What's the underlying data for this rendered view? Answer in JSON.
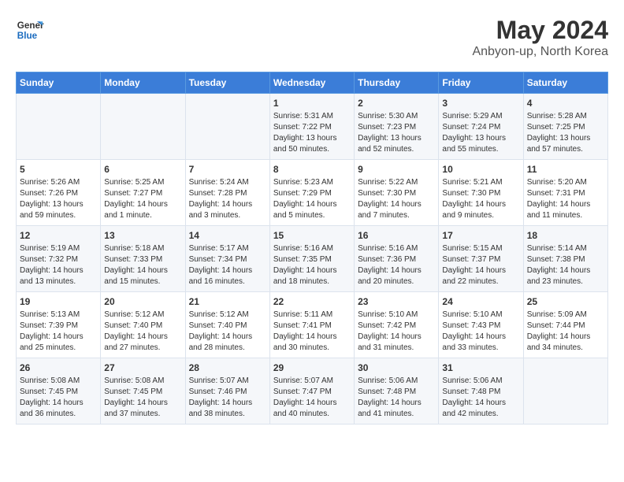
{
  "header": {
    "logo_general": "General",
    "logo_blue": "Blue",
    "main_title": "May 2024",
    "subtitle": "Anbyon-up, North Korea"
  },
  "days_of_week": [
    "Sunday",
    "Monday",
    "Tuesday",
    "Wednesday",
    "Thursday",
    "Friday",
    "Saturday"
  ],
  "weeks": [
    [
      {
        "day": "",
        "content": ""
      },
      {
        "day": "",
        "content": ""
      },
      {
        "day": "",
        "content": ""
      },
      {
        "day": "1",
        "content": "Sunrise: 5:31 AM\nSunset: 7:22 PM\nDaylight: 13 hours\nand 50 minutes."
      },
      {
        "day": "2",
        "content": "Sunrise: 5:30 AM\nSunset: 7:23 PM\nDaylight: 13 hours\nand 52 minutes."
      },
      {
        "day": "3",
        "content": "Sunrise: 5:29 AM\nSunset: 7:24 PM\nDaylight: 13 hours\nand 55 minutes."
      },
      {
        "day": "4",
        "content": "Sunrise: 5:28 AM\nSunset: 7:25 PM\nDaylight: 13 hours\nand 57 minutes."
      }
    ],
    [
      {
        "day": "5",
        "content": "Sunrise: 5:26 AM\nSunset: 7:26 PM\nDaylight: 13 hours\nand 59 minutes."
      },
      {
        "day": "6",
        "content": "Sunrise: 5:25 AM\nSunset: 7:27 PM\nDaylight: 14 hours\nand 1 minute."
      },
      {
        "day": "7",
        "content": "Sunrise: 5:24 AM\nSunset: 7:28 PM\nDaylight: 14 hours\nand 3 minutes."
      },
      {
        "day": "8",
        "content": "Sunrise: 5:23 AM\nSunset: 7:29 PM\nDaylight: 14 hours\nand 5 minutes."
      },
      {
        "day": "9",
        "content": "Sunrise: 5:22 AM\nSunset: 7:30 PM\nDaylight: 14 hours\nand 7 minutes."
      },
      {
        "day": "10",
        "content": "Sunrise: 5:21 AM\nSunset: 7:30 PM\nDaylight: 14 hours\nand 9 minutes."
      },
      {
        "day": "11",
        "content": "Sunrise: 5:20 AM\nSunset: 7:31 PM\nDaylight: 14 hours\nand 11 minutes."
      }
    ],
    [
      {
        "day": "12",
        "content": "Sunrise: 5:19 AM\nSunset: 7:32 PM\nDaylight: 14 hours\nand 13 minutes."
      },
      {
        "day": "13",
        "content": "Sunrise: 5:18 AM\nSunset: 7:33 PM\nDaylight: 14 hours\nand 15 minutes."
      },
      {
        "day": "14",
        "content": "Sunrise: 5:17 AM\nSunset: 7:34 PM\nDaylight: 14 hours\nand 16 minutes."
      },
      {
        "day": "15",
        "content": "Sunrise: 5:16 AM\nSunset: 7:35 PM\nDaylight: 14 hours\nand 18 minutes."
      },
      {
        "day": "16",
        "content": "Sunrise: 5:16 AM\nSunset: 7:36 PM\nDaylight: 14 hours\nand 20 minutes."
      },
      {
        "day": "17",
        "content": "Sunrise: 5:15 AM\nSunset: 7:37 PM\nDaylight: 14 hours\nand 22 minutes."
      },
      {
        "day": "18",
        "content": "Sunrise: 5:14 AM\nSunset: 7:38 PM\nDaylight: 14 hours\nand 23 minutes."
      }
    ],
    [
      {
        "day": "19",
        "content": "Sunrise: 5:13 AM\nSunset: 7:39 PM\nDaylight: 14 hours\nand 25 minutes."
      },
      {
        "day": "20",
        "content": "Sunrise: 5:12 AM\nSunset: 7:40 PM\nDaylight: 14 hours\nand 27 minutes."
      },
      {
        "day": "21",
        "content": "Sunrise: 5:12 AM\nSunset: 7:40 PM\nDaylight: 14 hours\nand 28 minutes."
      },
      {
        "day": "22",
        "content": "Sunrise: 5:11 AM\nSunset: 7:41 PM\nDaylight: 14 hours\nand 30 minutes."
      },
      {
        "day": "23",
        "content": "Sunrise: 5:10 AM\nSunset: 7:42 PM\nDaylight: 14 hours\nand 31 minutes."
      },
      {
        "day": "24",
        "content": "Sunrise: 5:10 AM\nSunset: 7:43 PM\nDaylight: 14 hours\nand 33 minutes."
      },
      {
        "day": "25",
        "content": "Sunrise: 5:09 AM\nSunset: 7:44 PM\nDaylight: 14 hours\nand 34 minutes."
      }
    ],
    [
      {
        "day": "26",
        "content": "Sunrise: 5:08 AM\nSunset: 7:45 PM\nDaylight: 14 hours\nand 36 minutes."
      },
      {
        "day": "27",
        "content": "Sunrise: 5:08 AM\nSunset: 7:45 PM\nDaylight: 14 hours\nand 37 minutes."
      },
      {
        "day": "28",
        "content": "Sunrise: 5:07 AM\nSunset: 7:46 PM\nDaylight: 14 hours\nand 38 minutes."
      },
      {
        "day": "29",
        "content": "Sunrise: 5:07 AM\nSunset: 7:47 PM\nDaylight: 14 hours\nand 40 minutes."
      },
      {
        "day": "30",
        "content": "Sunrise: 5:06 AM\nSunset: 7:48 PM\nDaylight: 14 hours\nand 41 minutes."
      },
      {
        "day": "31",
        "content": "Sunrise: 5:06 AM\nSunset: 7:48 PM\nDaylight: 14 hours\nand 42 minutes."
      },
      {
        "day": "",
        "content": ""
      }
    ]
  ]
}
